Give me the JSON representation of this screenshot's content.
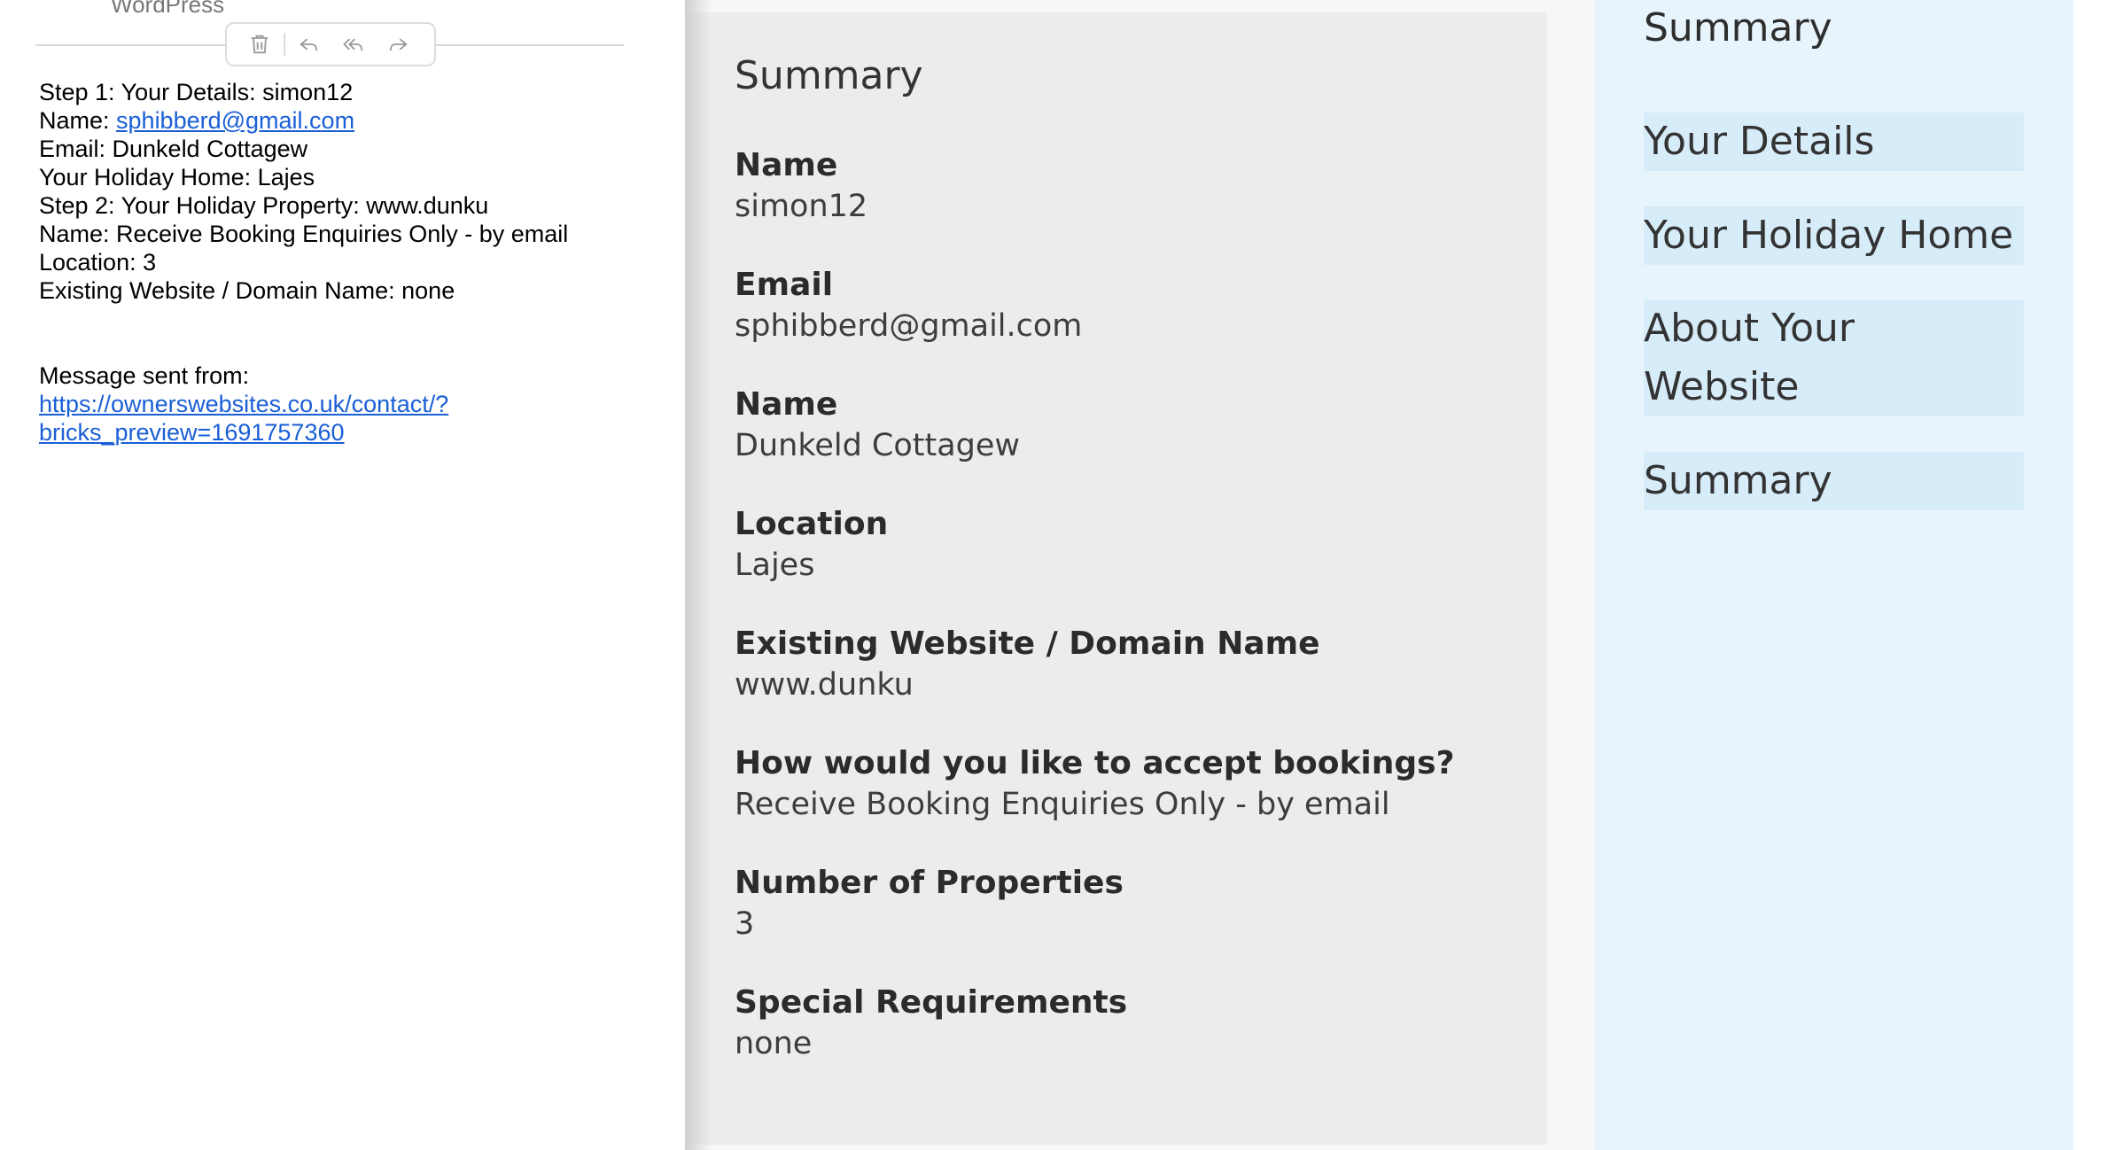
{
  "email": {
    "sender": "WordPress",
    "toolbar": {
      "icons": [
        "trash-icon",
        "reply-icon",
        "reply-all-icon",
        "forward-icon"
      ]
    },
    "lines": [
      "Step 1: Your Details: simon12",
      "Email: Dunkeld Cottagew",
      "Your Holiday Home: Lajes",
      "Step 2: Your Holiday Property: www.dunku",
      "Name: Receive Booking Enquiries Only - by email",
      "Location: 3",
      "Existing Website / Domain Name: none"
    ],
    "name_prefix": "Name: ",
    "name_link": "sphibberd@gmail.com",
    "message_sent_from": "Message sent from:",
    "source_link_line1": "https://ownerswebsites.co.uk/contact/?",
    "source_link_line2": "bricks_preview=1691757360"
  },
  "summary": {
    "title": "Summary",
    "fields": [
      {
        "label": "Name",
        "value": "simon12"
      },
      {
        "label": "Email",
        "value": "sphibberd@gmail.com"
      },
      {
        "label": "Name",
        "value": "Dunkeld Cottagew"
      },
      {
        "label": "Location",
        "value": "Lajes"
      },
      {
        "label": "Existing Website / Domain Name",
        "value": "www.dunku"
      },
      {
        "label": "How would you like to accept bookings?",
        "value": "Receive Booking Enquiries Only - by email"
      },
      {
        "label": "Number of Properties",
        "value": "3"
      },
      {
        "label": "Special Requirements",
        "value": "none"
      }
    ]
  },
  "steps": {
    "title": "Summary",
    "items": [
      {
        "label": "Your Details"
      },
      {
        "label": "Your Holiday Home"
      },
      {
        "label_line1": "About Your",
        "label_line2": "Website"
      },
      {
        "label": "Summary"
      }
    ]
  },
  "colors": {
    "link": "#1a5fd6",
    "card_bg": "#ececec",
    "sidebar_bg": "#e8f4fc",
    "step_bg": "#d7ecf9"
  }
}
